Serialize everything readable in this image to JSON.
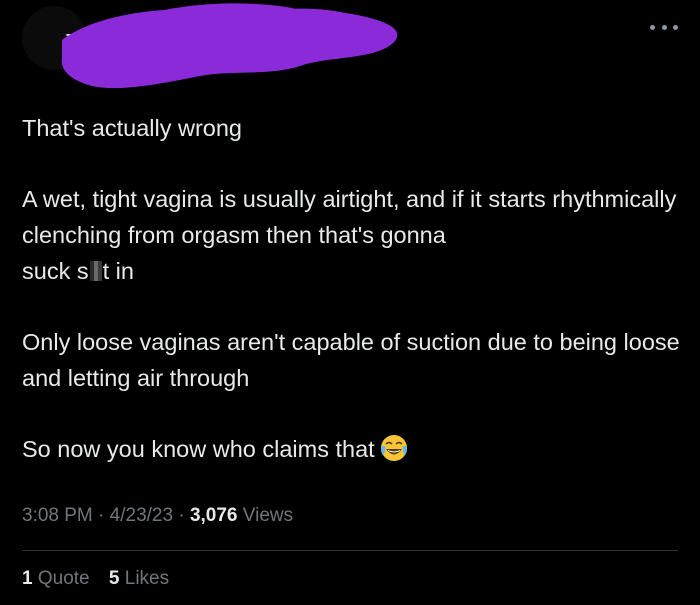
{
  "header": {
    "redaction_color": "#8a2ad8",
    "more_icon": "more-horizontal-icon"
  },
  "tweet": {
    "paragraphs": [
      "That's actually wrong",
      "A wet, tight vagina is usually airtight, and if it starts rhythmically clenching from orgasm then that's gonna",
      "Only loose vaginas aren't capable of suction due to being loose and letting air through",
      "So now you know who claims that"
    ],
    "line3_before": "suck s",
    "line3_after": "t in",
    "emoji": "face-with-tears-of-joy-icon"
  },
  "meta": {
    "time": "3:08 PM",
    "sep1": "·",
    "date": "4/23/23",
    "sep2": "·",
    "views_count": "3,076",
    "views_label": "Views"
  },
  "stats": {
    "quotes_count": "1",
    "quotes_label": "Quote",
    "likes_count": "5",
    "likes_label": "Likes"
  }
}
